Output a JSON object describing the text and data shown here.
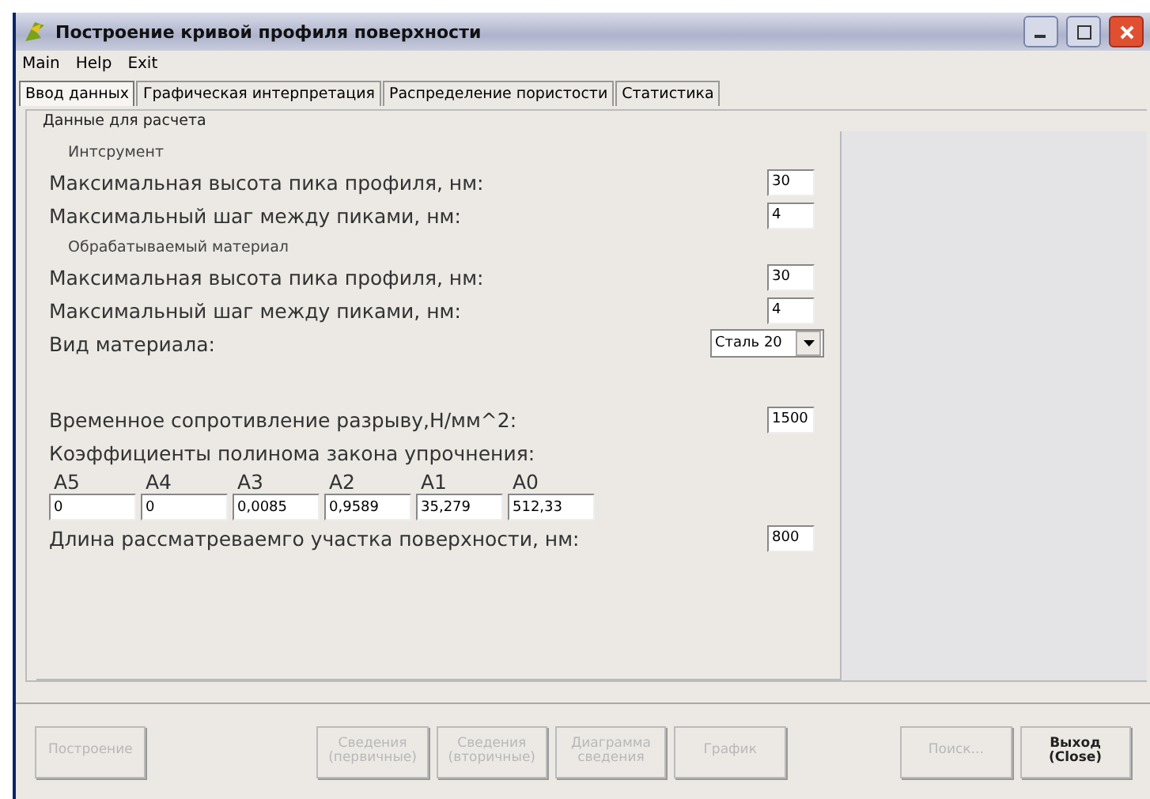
{
  "window": {
    "title": "Построение кривой профиля поверхности"
  },
  "menu": [
    "Main",
    "Help",
    "Exit"
  ],
  "tabs": [
    {
      "label": "Ввод данных",
      "selected": true
    },
    {
      "label": "Графическая интерпретация",
      "selected": false
    },
    {
      "label": "Распределение пористости",
      "selected": false
    },
    {
      "label": "Статистика",
      "selected": false
    }
  ],
  "group": {
    "legend": "Данные для расчета"
  },
  "rows": [
    {
      "kind": "heading",
      "label": "Интсрумент"
    },
    {
      "kind": "field",
      "label": "Максимальная высота пика профиля, нм:",
      "value": "30"
    },
    {
      "kind": "field",
      "label": "Максимальный шаг между пиками, нм:",
      "value": "4"
    },
    {
      "kind": "heading",
      "label": "Обрабатываемый материал"
    },
    {
      "kind": "field",
      "label": "Максимальная высота пика профиля, нм:",
      "value": "30"
    },
    {
      "kind": "field",
      "label": "Максимальный шаг между пиками, нм:",
      "value": "4"
    },
    {
      "kind": "select",
      "label": "Вид материала:",
      "value": "Сталь 20"
    },
    {
      "kind": "spacer"
    },
    {
      "kind": "field",
      "label": "Временное сопротивление разрыву,Н/мм^2:",
      "value": "1500"
    },
    {
      "kind": "caption",
      "label": "Коэффициенты полинома закона упрочнения:"
    },
    {
      "kind": "coefficients",
      "items": [
        {
          "label": "A5",
          "value": "0"
        },
        {
          "label": "A4",
          "value": "0"
        },
        {
          "label": "A3",
          "value": "0,0085"
        },
        {
          "label": "A2",
          "value": "0,9589"
        },
        {
          "label": "A1",
          "value": "35,279"
        },
        {
          "label": "A0",
          "value": "512,33"
        }
      ]
    },
    {
      "kind": "field",
      "label": "Длина рассматреваемго участка поверхности, нм:",
      "value": "800"
    }
  ],
  "buttons": [
    {
      "label": "Построение",
      "disabled": true
    },
    {
      "label": "Сведения (первичные)",
      "disabled": true
    },
    {
      "label": "Сведения (вторичные)",
      "disabled": true
    },
    {
      "label": "Диаграмма сведения",
      "disabled": true
    },
    {
      "label": "График",
      "disabled": true
    },
    {
      "label": "Поиск...",
      "disabled": true
    },
    {
      "label": "Выход (Close)",
      "disabled": false
    }
  ]
}
